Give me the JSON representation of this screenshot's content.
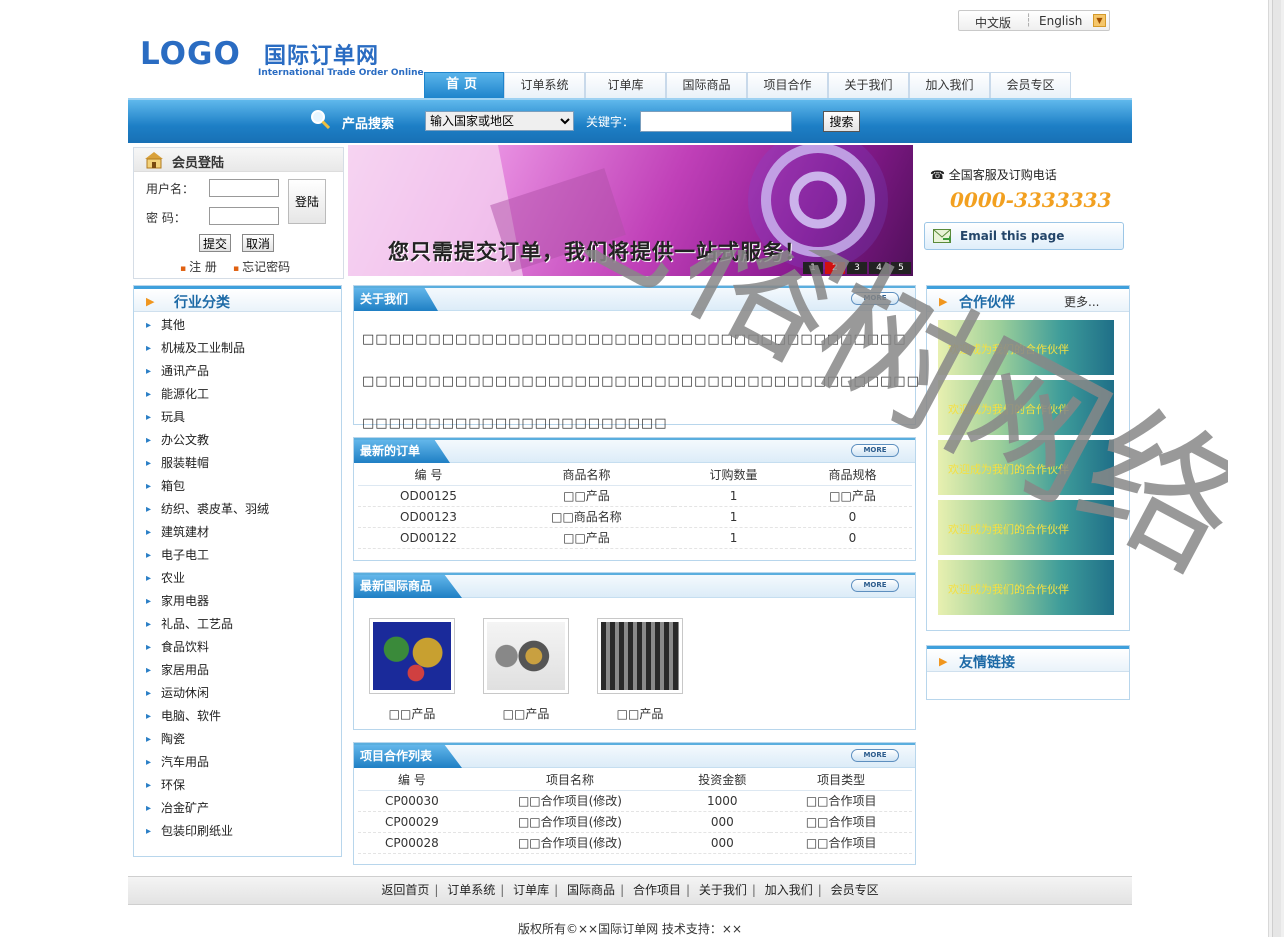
{
  "lang": {
    "zh": "中文版",
    "en": "English"
  },
  "logo": {
    "main": "LOGO",
    "cn": "国际订单网",
    "en": "International Trade Order Online"
  },
  "nav": [
    "首页",
    "订单系统",
    "订单库",
    "国际商品",
    "项目合作",
    "关于我们",
    "加入我们",
    "会员专区"
  ],
  "search": {
    "label": "产品搜索",
    "region": "输入国家或地区",
    "keyword_label": "关键字：",
    "button": "搜索"
  },
  "login": {
    "title": "会员登陆",
    "username_label": "用户名：",
    "password_label": "密  码：",
    "login_button": "登陆",
    "submit": "提交",
    "cancel": "取消",
    "register": "注 册",
    "forgot": "忘记密码"
  },
  "banner": {
    "slogan": "您只需提交订单，我们将提供一站式服务！",
    "pages": [
      "1",
      "2",
      "3",
      "4",
      "5"
    ],
    "active": 2
  },
  "service": {
    "label": "全国客服及订购电话",
    "phone": "0000-3333333",
    "email": "Email this page"
  },
  "categories": {
    "title": "行业分类",
    "items": [
      "其他",
      "机械及工业制品",
      "通讯产品",
      "能源化工",
      "玩具",
      "办公文教",
      "服装鞋帽",
      "箱包",
      "纺织、裘皮革、羽绒",
      "建筑建材",
      "电子电工",
      "农业",
      "家用电器",
      "礼品、工艺品",
      "食品饮料",
      "家居用品",
      "运动休闲",
      "电脑、软件",
      "陶瓷",
      "汽车用品",
      "环保",
      "冶金矿产",
      "包装印刷纸业"
    ]
  },
  "about": {
    "title": "关于我们",
    "more": "MORE",
    "lines": [
      "□□□□□□□□□□□□□□□□□□□□□□□□□□□□□□□□□□□□□□□□□",
      "□□□□□□□□□□□□□□□□□□□□□□□□□□□□□□□□□□□□□□□□□□",
      "□□□□□□□□□□□□□□□□□□□□□□□"
    ]
  },
  "orders": {
    "title": "最新的订单",
    "more": "MORE",
    "headers": [
      "编 号",
      "商品名称",
      "订购数量",
      "商品规格"
    ],
    "rows": [
      [
        "OD00125",
        "□□产品",
        "1",
        "□□产品"
      ],
      [
        "OD00123",
        "□□商品名称",
        "1",
        "0"
      ],
      [
        "OD00122",
        "□□产品",
        "1",
        "0"
      ]
    ]
  },
  "goods": {
    "title": "最新国际商品",
    "more": "MORE",
    "items": [
      "□□产品",
      "□□产品",
      "□□产品"
    ]
  },
  "projects": {
    "title": "项目合作列表",
    "more": "MORE",
    "headers": [
      "编 号",
      "项目名称",
      "投资金额",
      "项目类型"
    ],
    "rows": [
      [
        "CP00030",
        "□□合作项目(修改)",
        "1000",
        "□□合作项目"
      ],
      [
        "CP00029",
        "□□合作项目(修改)",
        "000",
        "□□合作项目"
      ],
      [
        "CP00028",
        "□□合作项目(修改)",
        "000",
        "□□合作项目"
      ]
    ]
  },
  "partners": {
    "title": "合作伙伴",
    "more": "更多...",
    "items": [
      "欢迎成为我们的合作伙伴",
      "欢迎成为我们的合作伙伴",
      "欢迎成为我们的合作伙伴",
      "欢迎成为我们的合作伙伴",
      "欢迎成为我们的合作伙伴"
    ]
  },
  "links": {
    "title": "友情链接"
  },
  "footer": {
    "nav": [
      "返回首页",
      "订单系统",
      "订单库",
      "国际商品",
      "合作项目",
      "关于我们",
      "加入我们",
      "会员专区"
    ],
    "copyright": "版权所有©××国际订单网  技术支持：××"
  },
  "watermark": "老榕树网络",
  "colors": {
    "brand_blue": "#1e84cc",
    "phone_orange": "#f2a020",
    "banner_pink": "#c040b8"
  }
}
